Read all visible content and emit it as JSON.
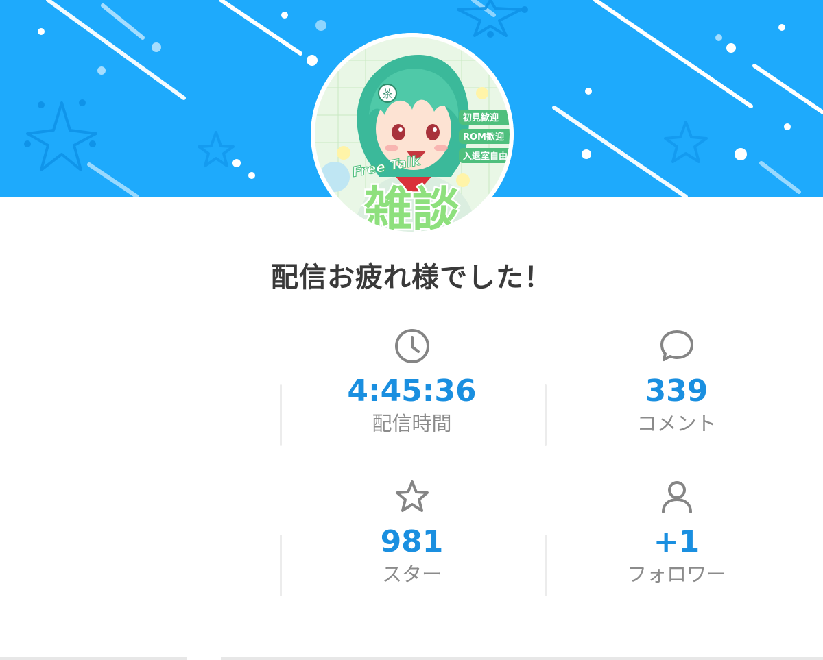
{
  "title": "配信お疲れ様でした！",
  "avatar": {
    "badges": [
      "初見歓迎",
      "ROM歓迎",
      "入退室自由"
    ],
    "overlay_text": "Free Talk",
    "big_text": "雑談",
    "tag_glyph": "茶"
  },
  "stats": {
    "duration": {
      "value": "4:45:36",
      "label": "配信時間",
      "icon": "clock-icon"
    },
    "comments": {
      "value": "339",
      "label": "コメント",
      "icon": "speech-bubble-icon"
    },
    "stars": {
      "value": "981",
      "label": "スター",
      "icon": "star-icon"
    },
    "followers": {
      "value": "+1",
      "label": "フォロワー",
      "icon": "person-icon"
    }
  },
  "colors": {
    "banner": "#1eaafc",
    "accent": "#1a8fe0",
    "label": "#8b8b8b",
    "icon": "#858585"
  }
}
